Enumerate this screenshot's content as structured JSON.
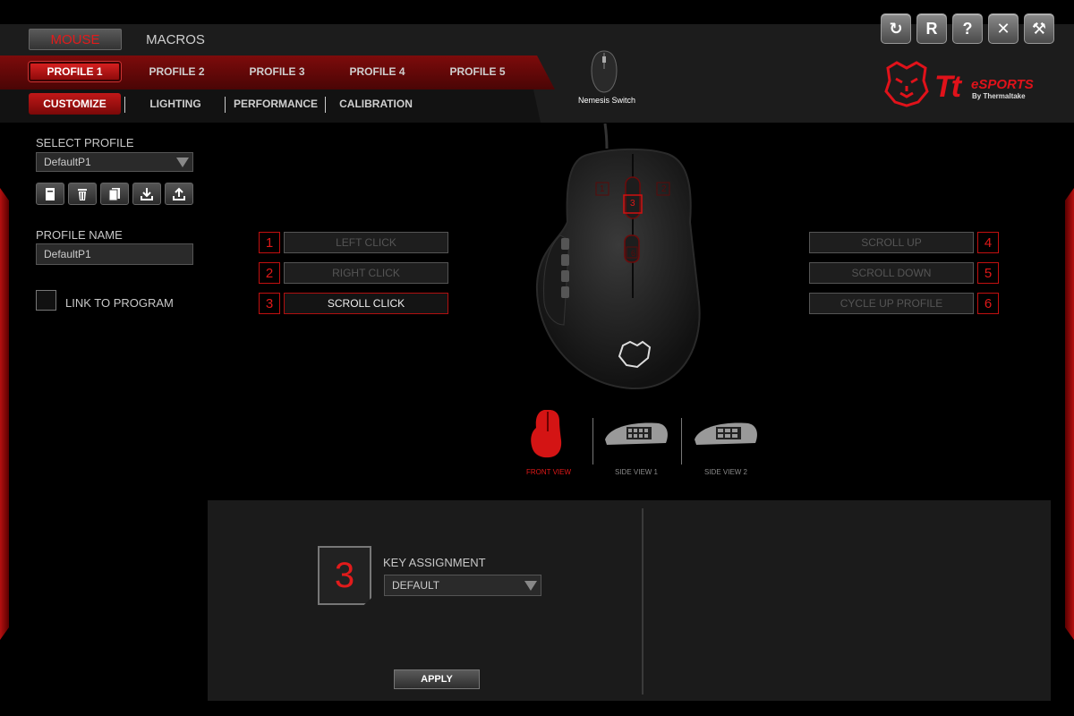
{
  "main_tabs": [
    {
      "label": "MOUSE"
    },
    {
      "label": "MACROS"
    }
  ],
  "profile_tabs": [
    {
      "label": "PROFILE 1"
    },
    {
      "label": "PROFILE 2"
    },
    {
      "label": "PROFILE 3"
    },
    {
      "label": "PROFILE 4"
    },
    {
      "label": "PROFILE 5"
    }
  ],
  "sub_tabs": [
    {
      "label": "CUSTOMIZE"
    },
    {
      "label": "LIGHTING"
    },
    {
      "label": "PERFORMANCE"
    },
    {
      "label": "CALIBRATION"
    }
  ],
  "header_buttons": [
    {
      "icon": "refresh-icon",
      "glyph": "↻"
    },
    {
      "icon": "reset-icon",
      "glyph": "R"
    },
    {
      "icon": "help-icon",
      "glyph": "?"
    },
    {
      "icon": "close-icon",
      "glyph": "✕"
    },
    {
      "icon": "settings-tools-icon",
      "glyph": "⚒"
    }
  ],
  "device": {
    "name": "Nemesis Switch"
  },
  "brand": {
    "tt": "Tt",
    "esports": "eSPORTS",
    "by": "By Thermaltake"
  },
  "left_panel": {
    "select_profile_label": "SELECT PROFILE",
    "select_profile_value": "DefaultP1",
    "profile_name_label": "PROFILE NAME",
    "profile_name_value": "DefaultP1",
    "link_to_program_label": "LINK TO PROGRAM",
    "link_to_program_checked": false,
    "tools": [
      "new-profile-icon",
      "delete-icon",
      "copy-icon",
      "import-icon",
      "export-icon"
    ]
  },
  "mapping": {
    "left": [
      {
        "num": "1",
        "label": "LEFT CLICK"
      },
      {
        "num": "2",
        "label": "RIGHT CLICK"
      },
      {
        "num": "3",
        "label": "SCROLL CLICK"
      }
    ],
    "right": [
      {
        "num": "4",
        "label": "SCROLL UP"
      },
      {
        "num": "5",
        "label": "SCROLL DOWN"
      },
      {
        "num": "6",
        "label": "CYCLE UP PROFILE"
      }
    ],
    "selected": "3"
  },
  "mouse_labels": [
    "1",
    "3",
    "2",
    "6"
  ],
  "views": [
    {
      "label": "FRONT VIEW"
    },
    {
      "label": "SIDE VIEW 1"
    },
    {
      "label": "SIDE VIEW 2"
    }
  ],
  "key_assignment": {
    "selected_key": "3",
    "label": "KEY ASSIGNMENT",
    "value": "DEFAULT",
    "apply_label": "APPLY"
  },
  "colors": {
    "accent": "#e21b1b",
    "panel": "#1b1b1b"
  }
}
